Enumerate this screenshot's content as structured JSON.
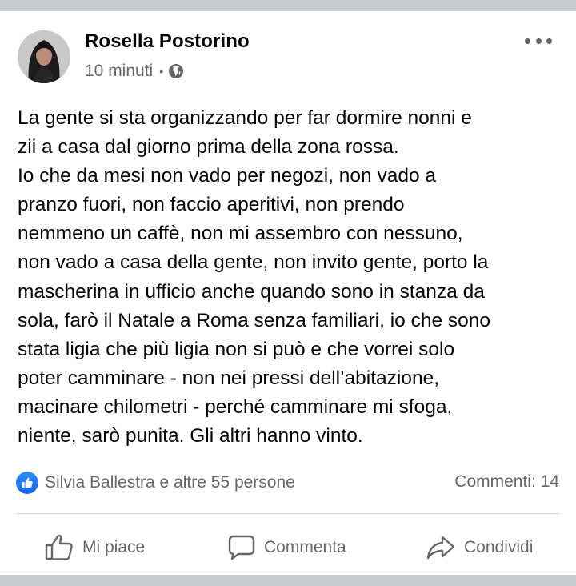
{
  "post": {
    "author": "Rosella Postorino",
    "time": "10 minuti",
    "separator": "•",
    "privacy_icon": "globe-icon",
    "more_icon": "more-options-icon",
    "text_lines": [
      "La gente si sta organizzando per far dormire nonni e",
      "zii a casa dal giorno prima della zona rossa.",
      "Io che da mesi non vado per negozi, non vado a",
      "pranzo fuori, non faccio aperitivi, non prendo",
      "nemmeno un caffè, non mi assembro con nessuno,",
      "non vado a casa della gente, non invito gente, porto la",
      "mascherina in ufficio anche quando sono in stanza da",
      "sola, farò il Natale a Roma senza familiari, io che sono",
      "stata ligia che più ligia non si può e che vorrei solo",
      "poter camminare - non nei pressi dell’abitazione,",
      "macinare chilometri - perché camminare mi sfoga,",
      "niente, sarò punita. Gli altri hanno vinto."
    ]
  },
  "reactions": {
    "summary": "Silvia Ballestra e altre 55 persone",
    "comments": "Commenti: 14",
    "like_color": "#1877f2"
  },
  "actions": {
    "like": "Mi piace",
    "comment": "Commenta",
    "share": "Condividi"
  }
}
